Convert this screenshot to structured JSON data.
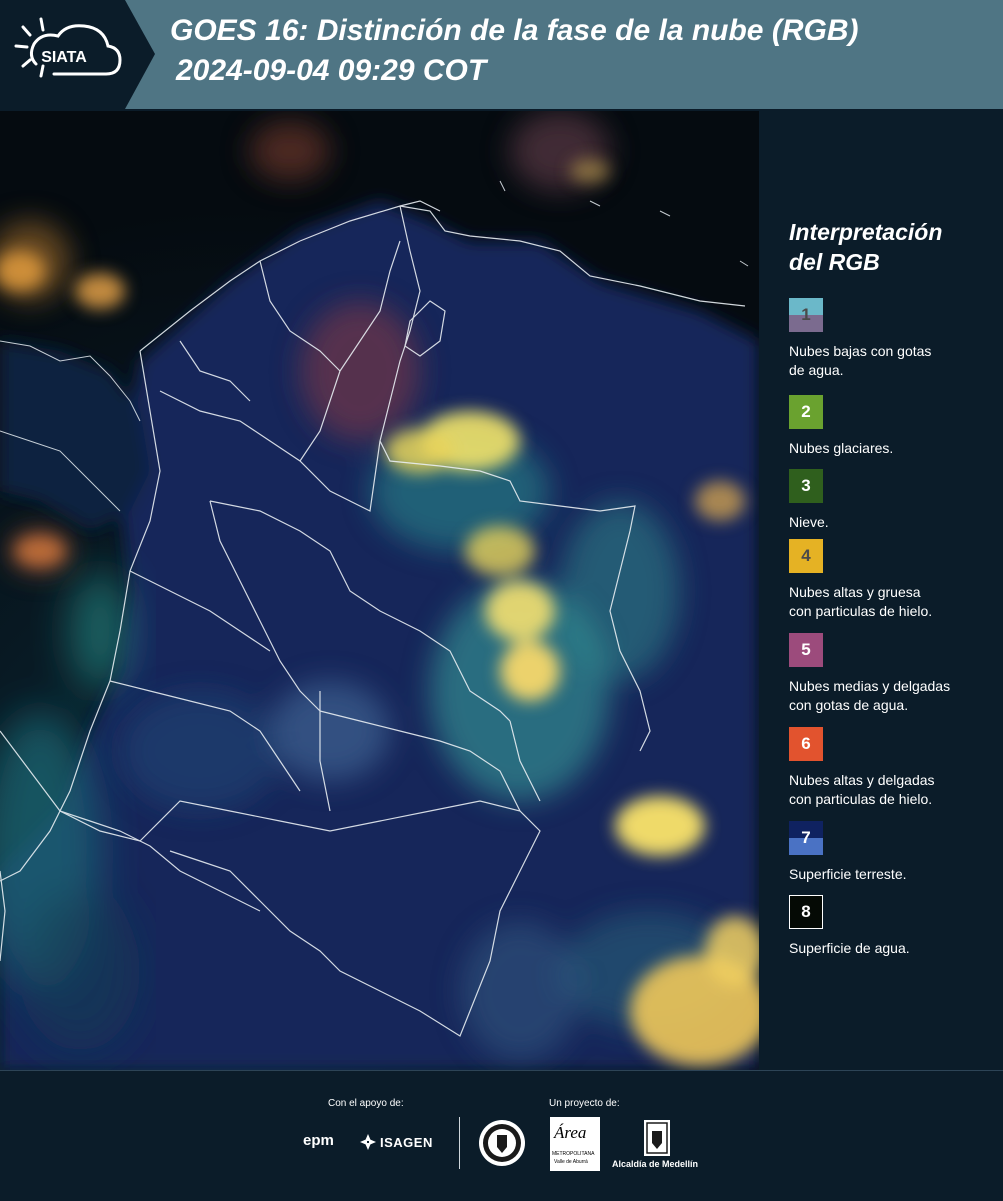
{
  "header": {
    "logo_text": "SIATA",
    "title_line1": "GOES 16: Distinción de la fase de la nube (RGB)",
    "title_line2": "2024-09-04 09:29 COT"
  },
  "legend": {
    "title_line1": "Interpretación",
    "title_line2": "del RGB",
    "items": [
      {
        "num": "1",
        "label_l1": "Nubes bajas con gotas",
        "label_l2": "de agua.",
        "color_top": "#6bb8c9",
        "color_bottom": "#7b6b8f",
        "text_color": "#4a4a4a"
      },
      {
        "num": "2",
        "label_l1": "Nubes glaciares.",
        "label_l2": "",
        "color": "#6aa22f",
        "text_color": "#ffffff"
      },
      {
        "num": "3",
        "label_l1": "Nieve.",
        "label_l2": "",
        "color": "#2f5f1d",
        "text_color": "#ffffff"
      },
      {
        "num": "4",
        "label_l1": "Nubes altas y gruesa",
        "label_l2": "con particulas de hielo.",
        "color": "#e5b224",
        "text_color": "#4a4a4a"
      },
      {
        "num": "5",
        "label_l1": "Nubes medias y delgadas",
        "label_l2": "con gotas de agua.",
        "color": "#9c4b7c",
        "text_color": "#ffffff"
      },
      {
        "num": "6",
        "label_l1": "Nubes altas y delgadas",
        "label_l2": "con particulas de hielo.",
        "color": "#e2532e",
        "text_color": "#ffffff"
      },
      {
        "num": "7",
        "label_l1": "Superficie terreste.",
        "label_l2": "",
        "color_top": "#0f2260",
        "color_bottom": "#4a72c4",
        "text_color": "#ffffff"
      },
      {
        "num": "8",
        "label_l1": "Superficie de agua.",
        "label_l2": "",
        "color": "#050a05",
        "text_color": "#ffffff",
        "border": "#ffffff"
      }
    ]
  },
  "footer": {
    "support_label": "Con el apoyo de:",
    "project_label": "Un proyecto de:",
    "epm": "epm",
    "isagen": "ISAGEN",
    "area_line1": "Área",
    "area_line2": "METROPOLITANA",
    "area_line3": "Valle de Aburrá",
    "alcaldia": "Alcaldía de Medellín"
  }
}
